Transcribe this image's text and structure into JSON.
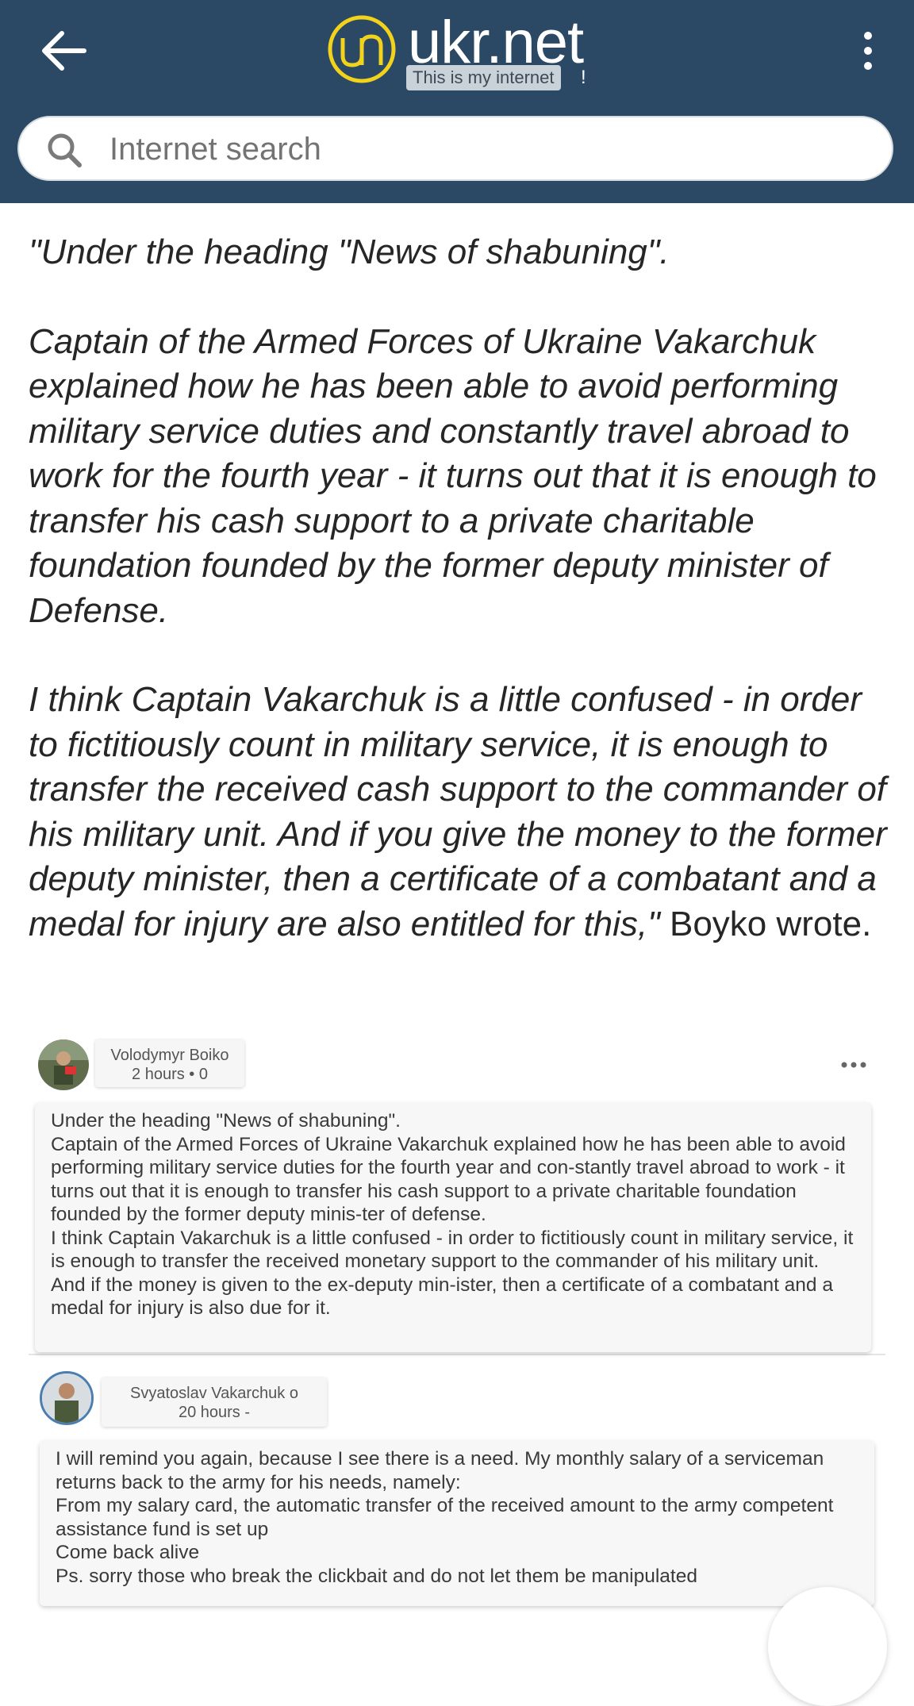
{
  "header": {
    "logo_text": "ukr.net",
    "tagline": "This is my internet",
    "tagline_suffix": "!",
    "back_icon": "arrow-left-icon",
    "menu_icon": "more-vertical-icon",
    "colors": {
      "bar": "#2b4964",
      "logo_ring": "#f2d21b"
    }
  },
  "search": {
    "placeholder": "Internet search",
    "value": "",
    "icon": "search-icon"
  },
  "article": {
    "paragraphs": [
      "\"Under the heading \"News of shabuning\".",
      "Captain of the Armed Forces of Ukraine Vakarchuk explained how he has been able to avoid performing military service duties and constantly travel abroad to work for the fourth year - it turns out that it is enough to transfer his cash support to a private charitable foundation founded by the former deputy minister of Defense.",
      "I think Captain Vakarchuk is a little confused - in order to fictitiously count in military service, it is enough to transfer the received cash support to the commander of his military unit. And if you give the money to the former deputy minister, then a certificate of a combatant and a medal for injury are also entitled for this,\""
    ],
    "attribution": " Boyko wrote."
  },
  "posts": [
    {
      "author": "Volodymyr Boiko",
      "meta": "2 hours • 0",
      "text": "Under the heading \"News of shabuning\".\nCaptain of the Armed Forces of Ukraine Vakarchuk explained how he has been able to avoid performing military service duties for the fourth year and con-stantly travel abroad to work - it turns out that it is enough to transfer his cash support to a private charitable foundation founded by the former deputy minis-ter of defense.\nI think Captain Vakarchuk is a little confused - in order to fictitiously count in military service, it is enough to transfer the received monetary support to the commander of his military unit. And if the money is given to the ex-deputy min-ister, then a certificate of a combatant and a medal for injury is also due for it."
    },
    {
      "author": "Svyatoslav Vakarchuk o",
      "meta": "20 hours -",
      "text": "I will remind you again, because I see there is a need. My monthly salary of a serviceman returns back to the army for his needs, namely:\nFrom my salary card, the automatic transfer of the received amount to the army competent assistance fund is set up\nCome back alive\nPs. sorry those who break the clickbait and do not let them be manipulated"
    }
  ]
}
